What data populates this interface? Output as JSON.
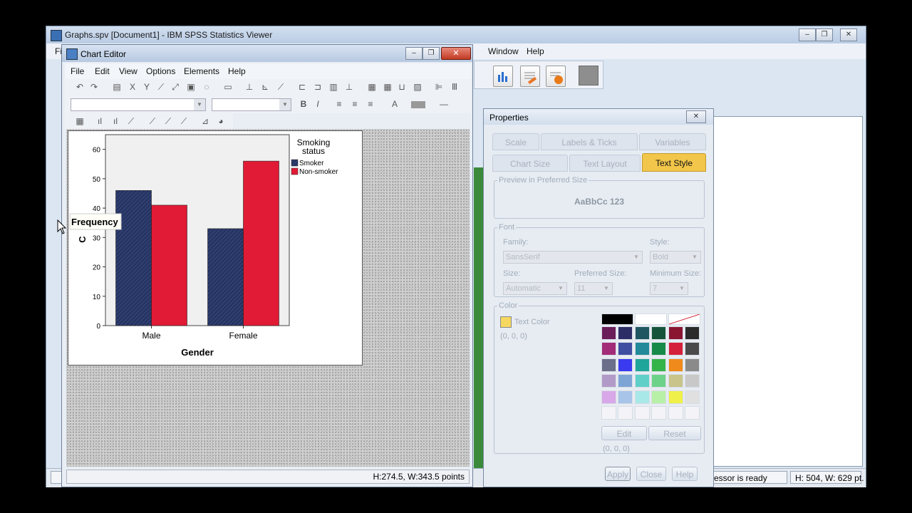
{
  "viewer": {
    "title": "Graphs.spv [Document1] - IBM SPSS Statistics Viewer",
    "menu_edge": "Fi",
    "menu": [
      "Window",
      "Help"
    ],
    "status_processor": "essor is ready",
    "status_dims": "H: 504, W: 629 pt."
  },
  "editor": {
    "title": "Chart Editor",
    "menu": [
      "File",
      "Edit",
      "View",
      "Options",
      "Elements",
      "Help"
    ],
    "status_dims": "H:274.5, W:343.5 points"
  },
  "chart_data": {
    "type": "bar",
    "categories": [
      "Male",
      "Female"
    ],
    "series": [
      {
        "name": "Smoker",
        "values": [
          46,
          33
        ],
        "color": "#263463"
      },
      {
        "name": "Non-smoker",
        "values": [
          41,
          56
        ],
        "color": "#e11b35"
      }
    ],
    "xlabel": "Gender",
    "ylabel": "Frequency",
    "ylim": [
      0,
      65
    ],
    "yticks": [
      0,
      10,
      20,
      30,
      40,
      50,
      60
    ],
    "legend_title": "Smoking status",
    "legend_position": "right",
    "grid": false,
    "ylabel_obscured_fragment": "C"
  },
  "properties": {
    "title": "Properties",
    "tabs_row1": [
      "Scale",
      "Labels & Ticks",
      "Variables"
    ],
    "tabs_row2": [
      "Chart Size",
      "Text Layout",
      "Text Style"
    ],
    "active_tab": "Text Style",
    "preview_group": "Preview in Preferred Size",
    "preview_text": "AaBbCc 123",
    "font_group": "Font",
    "family_label": "Family:",
    "family_value": "SansSerif",
    "style_label": "Style:",
    "style_value": "Bold",
    "size_label": "Size:",
    "size_value": "Automatic",
    "preferred_size_label": "Preferred Size:",
    "preferred_size_value": "11",
    "minimum_size_label": "Minimum Size:",
    "minimum_size_value": "7",
    "color_group": "Color",
    "text_color_label": "Text Color",
    "text_color_rgb": "(0, 0, 0)",
    "selected_color_rgb": "(0, 0, 0)",
    "edit_button": "Edit",
    "reset_button": "Reset",
    "apply_button": "Apply",
    "close_button": "Close",
    "help_button": "Help",
    "palette": [
      [
        "#000000",
        "#ffffff",
        "none"
      ],
      [
        "#6b1e5a",
        "#2c2d66",
        "#1f5662",
        "#15543a",
        "#8a1530",
        "#2b2b2b"
      ],
      [
        "#a22c78",
        "#3f4ea0",
        "#22899a",
        "#178a4a",
        "#d4203a",
        "#4a4a4a"
      ],
      [
        "#6c6f8a",
        "#3a3af0",
        "#1fa59a",
        "#35b44a",
        "#f08a1a",
        "#8a8a8a"
      ],
      [
        "#b29ac8",
        "#7ea4d6",
        "#5fcfc8",
        "#6cd28a",
        "#c8c48a",
        "#c8c8c8"
      ],
      [
        "#d8a8e8",
        "#a8c4e8",
        "#a8e8e8",
        "#b8f0a8",
        "#f0f04a",
        "#e0e0e0"
      ],
      [
        "#f4f4f8",
        "#f4f4f8",
        "#f4f4f8",
        "#f4f4f8",
        "#f4f4f8",
        "#f4f4f8"
      ]
    ]
  }
}
